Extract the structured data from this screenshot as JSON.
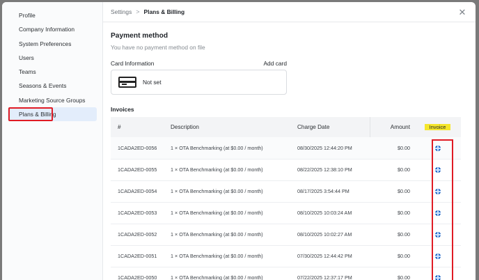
{
  "sidebar": {
    "items": [
      {
        "label": "Profile"
      },
      {
        "label": "Company Information"
      },
      {
        "label": "System Preferences"
      },
      {
        "label": "Users"
      },
      {
        "label": "Teams"
      },
      {
        "label": "Seasons & Events"
      },
      {
        "label": "Marketing Source Groups"
      },
      {
        "label": "Plans & Billing",
        "active": true
      }
    ]
  },
  "breadcrumb": {
    "root": "Settings",
    "separator": ">",
    "current": "Plans & Billing"
  },
  "close_icon": "close-icon",
  "payment": {
    "title": "Payment method",
    "subtitle": "You have no payment method on file",
    "card_label": "Card Information",
    "add_card": "Add card",
    "card_state": "Not set"
  },
  "invoices": {
    "title": "Invoices",
    "columns": {
      "num": "#",
      "desc": "Description",
      "date": "Charge Date",
      "amount": "Amount",
      "invoice": "Invoice"
    },
    "rows": [
      {
        "num": "1CADA2ED-0056",
        "desc": "1 × OTA Benchmarking (at $0.00 / month)",
        "date": "08/30/2025 12:44:20 PM",
        "amount": "$0.00"
      },
      {
        "num": "1CADA2ED-0055",
        "desc": "1 × OTA Benchmarking (at $0.00 / month)",
        "date": "08/22/2025 12:38:10 PM",
        "amount": "$0.00"
      },
      {
        "num": "1CADA2ED-0054",
        "desc": "1 × OTA Benchmarking (at $0.00 / month)",
        "date": "08/17/2025 3:54:44 PM",
        "amount": "$0.00"
      },
      {
        "num": "1CADA2ED-0053",
        "desc": "1 × OTA Benchmarking (at $0.00 / month)",
        "date": "08/10/2025 10:03:24 AM",
        "amount": "$0.00"
      },
      {
        "num": "1CADA2ED-0052",
        "desc": "1 × OTA Benchmarking (at $0.00 / month)",
        "date": "08/10/2025 10:02:27 AM",
        "amount": "$0.00"
      },
      {
        "num": "1CADA2ED-0051",
        "desc": "1 × OTA Benchmarking (at $0.00 / month)",
        "date": "07/30/2025 12:44:42 PM",
        "amount": "$0.00"
      },
      {
        "num": "1CADA2ED-0050",
        "desc": "1 × OTA Benchmarking (at $0.00 / month)",
        "date": "07/22/2025 12:37:17 PM",
        "amount": "$0.00"
      }
    ]
  },
  "colors": {
    "accent_highlight": "#e01b24",
    "invoice_header_marker": "#f5e62b",
    "invoice_icon": "#2f7de1",
    "active_item_bg": "#e3edfb"
  }
}
